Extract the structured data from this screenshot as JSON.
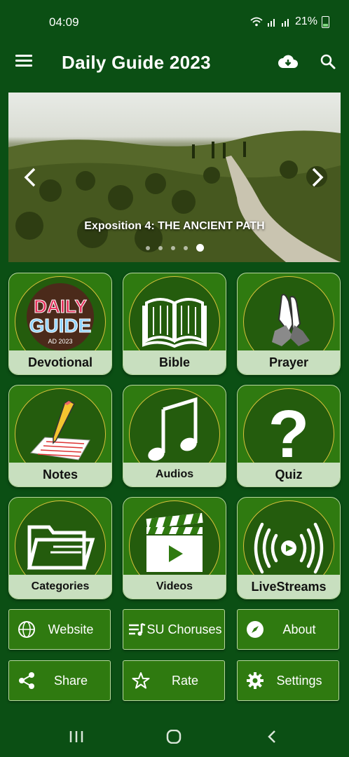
{
  "status": {
    "time": "04:09",
    "battery": "21%"
  },
  "appbar": {
    "title": "Daily Guide 2023"
  },
  "banner": {
    "caption": "Exposition 4: THE ANCIENT PATH",
    "dot_count": 5,
    "active_dot": 5
  },
  "tiles": [
    {
      "label": "Devotional",
      "icon": "daily-guide-logo",
      "logo": {
        "line1": "DAILY",
        "line2": "GUIDE",
        "line3": "AD 2023"
      }
    },
    {
      "label": "Bible",
      "icon": "open-book-icon"
    },
    {
      "label": "Prayer",
      "icon": "praying-hands-icon"
    },
    {
      "label": "Notes",
      "icon": "pencil-paper-icon"
    },
    {
      "label": "Audios",
      "icon": "music-note-icon"
    },
    {
      "label": "Quiz",
      "icon": "question-mark-icon"
    },
    {
      "label": "Categories",
      "icon": "folder-icon"
    },
    {
      "label": "Videos",
      "icon": "clapperboard-icon"
    },
    {
      "label": "LiveStreams",
      "icon": "broadcast-icon"
    }
  ],
  "buttons": [
    {
      "label": "Website",
      "icon": "globe-icon"
    },
    {
      "label": "SU Choruses",
      "icon": "playlist-icon"
    },
    {
      "label": "About",
      "icon": "compass-icon"
    },
    {
      "label": "Share",
      "icon": "share-icon"
    },
    {
      "label": "Rate",
      "icon": "star-icon"
    },
    {
      "label": "Settings",
      "icon": "gear-icon"
    }
  ]
}
